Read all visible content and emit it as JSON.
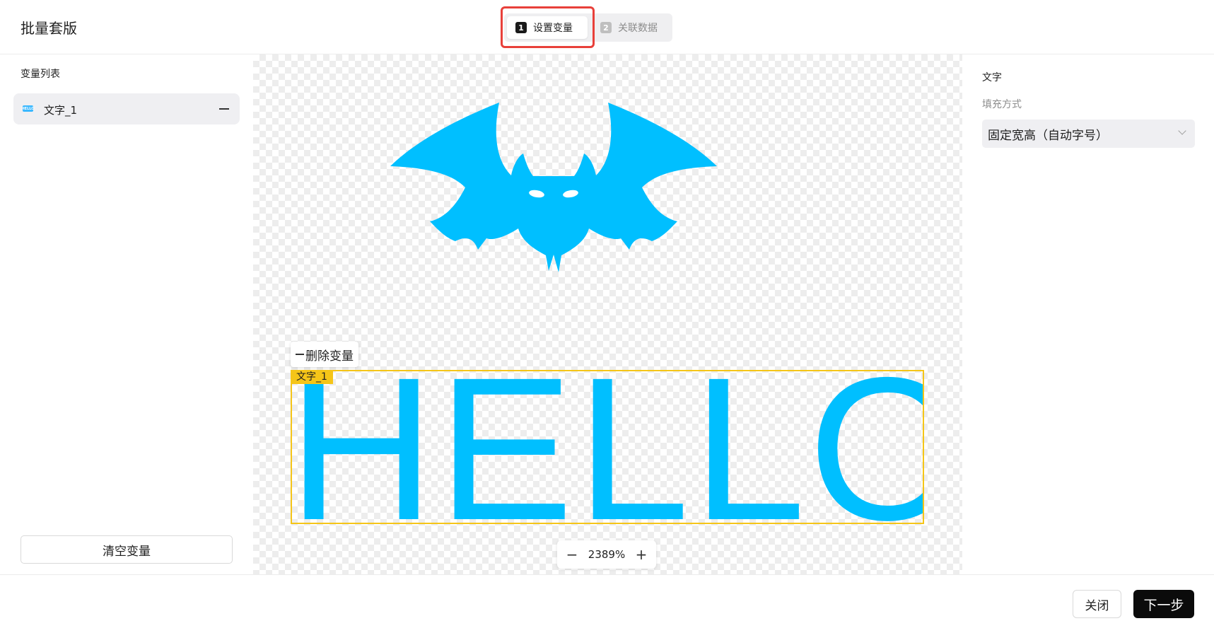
{
  "header": {
    "title": "批量套版",
    "steps": [
      {
        "number": "1",
        "label": "设置变量",
        "active": true
      },
      {
        "number": "2",
        "label": "关联数据",
        "active": false
      }
    ]
  },
  "left_panel": {
    "heading": "变量列表",
    "variables": [
      {
        "icon": "text-variable-icon",
        "icon_text": "HELLO",
        "label": "文字_1"
      }
    ],
    "clear_button": "清空变量"
  },
  "canvas": {
    "image": "bat-graphic",
    "text_content": "HELLO",
    "variable_tag": "文字_1",
    "delete_variable_button": "删除变量",
    "zoom": "2389%",
    "colors": {
      "artwork": "#00bfff",
      "selection": "#f5c518"
    }
  },
  "right_panel": {
    "heading": "文字",
    "fill_mode_label": "填充方式",
    "fill_mode_value": "固定宽高（自动字号）"
  },
  "footer": {
    "close_button": "关闭",
    "next_button": "下一步"
  },
  "colors": {
    "highlight": "#e8403a",
    "primary_button": "#0b0b0b"
  }
}
